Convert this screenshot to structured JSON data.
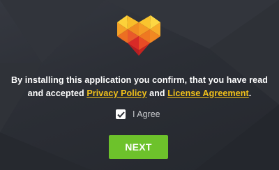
{
  "message": {
    "text_before": "By installing this application you confirm, that you have read and accepted ",
    "privacy_link": "Privacy Policy",
    "text_middle": " and ",
    "license_link": "License Agreement",
    "text_after": "."
  },
  "agree": {
    "label": "I Agree",
    "checked": true
  },
  "next_button": {
    "label": "NEXT"
  },
  "colors": {
    "background": "#2b2e35",
    "link": "#f3c21a",
    "button": "#6dc22b",
    "logo_palette": [
      "#fcd13a",
      "#f7a823",
      "#ef7821",
      "#e94b25",
      "#d92a27",
      "#b71e22"
    ]
  },
  "icons": {
    "logo": "heart-polygon-logo-icon",
    "checkbox": "checkmark-icon"
  }
}
